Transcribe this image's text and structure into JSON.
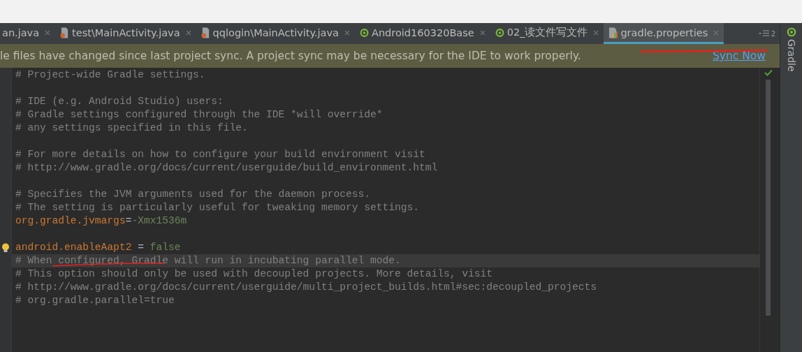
{
  "tabs": [
    {
      "label": "an.java",
      "selected": false
    },
    {
      "label": "test\\MainActivity.java",
      "kind": "java",
      "selected": false
    },
    {
      "label": "qqlogin\\MainActivity.java",
      "kind": "java",
      "selected": false
    },
    {
      "label": "Android160320Base",
      "kind": "gradle",
      "selected": false
    },
    {
      "label": "02_读文件写文件",
      "kind": "gradle",
      "selected": false
    },
    {
      "label": "gradle.properties",
      "kind": "properties",
      "selected": true
    }
  ],
  "tab_overflow": {
    "count": "2"
  },
  "notification": {
    "message": "le files have changed since last project sync. A project sync may be necessary for the IDE to work properly.",
    "action": "Sync Now"
  },
  "editor": {
    "lines": [
      {
        "current": false,
        "segments": [
          {
            "kind": "comment",
            "text": "# Project-wide Gradle settings."
          }
        ]
      },
      {
        "current": false
      },
      {
        "current": false,
        "segments": [
          {
            "kind": "comment",
            "text": "# IDE (e.g. Android Studio) users:"
          }
        ]
      },
      {
        "current": false,
        "segments": [
          {
            "kind": "comment",
            "text": "# Gradle settings configured through the IDE *will override*"
          }
        ]
      },
      {
        "current": false,
        "segments": [
          {
            "kind": "comment",
            "text": "# any settings specified in this file."
          }
        ]
      },
      {
        "current": false
      },
      {
        "current": false,
        "segments": [
          {
            "kind": "comment",
            "text": "# For more details on how to configure your build environment visit"
          }
        ]
      },
      {
        "current": false,
        "segments": [
          {
            "kind": "comment",
            "text": "# http://www.gradle.org/docs/current/userguide/build_environment.html"
          }
        ]
      },
      {
        "current": false
      },
      {
        "current": false,
        "segments": [
          {
            "kind": "comment",
            "text": "# Specifies the JVM arguments used for the daemon process."
          }
        ]
      },
      {
        "current": false,
        "segments": [
          {
            "kind": "comment",
            "text": "# The setting is particularly useful for tweaking memory settings."
          }
        ]
      },
      {
        "current": false,
        "segments": [
          {
            "kind": "key",
            "text": "org.gradle.jvmargs"
          },
          {
            "kind": "op",
            "text": "="
          },
          {
            "kind": "value",
            "text": "-Xmx1536m"
          }
        ]
      },
      {
        "current": false
      },
      {
        "current": false,
        "bulb": true,
        "segments": [
          {
            "kind": "key",
            "text": "android.enableAapt2"
          },
          {
            "kind": "op",
            "text": " = "
          },
          {
            "kind": "value",
            "text": "false"
          }
        ]
      },
      {
        "current": true,
        "segments": [
          {
            "kind": "comment",
            "text": "# When configured, Gradle will run in incubating parallel mode."
          }
        ]
      },
      {
        "current": false,
        "segments": [
          {
            "kind": "comment",
            "text": "# This option should only be used with decoupled projects. More details, visit"
          }
        ]
      },
      {
        "current": false,
        "segments": [
          {
            "kind": "comment",
            "text": "# http://www.gradle.org/docs/current/userguide/multi_project_builds.html#sec:decoupled_projects"
          }
        ]
      },
      {
        "current": false,
        "segments": [
          {
            "kind": "comment",
            "text": "# org.gradle.parallel=true"
          }
        ]
      }
    ]
  },
  "side_panel": {
    "label": "Gradle"
  }
}
